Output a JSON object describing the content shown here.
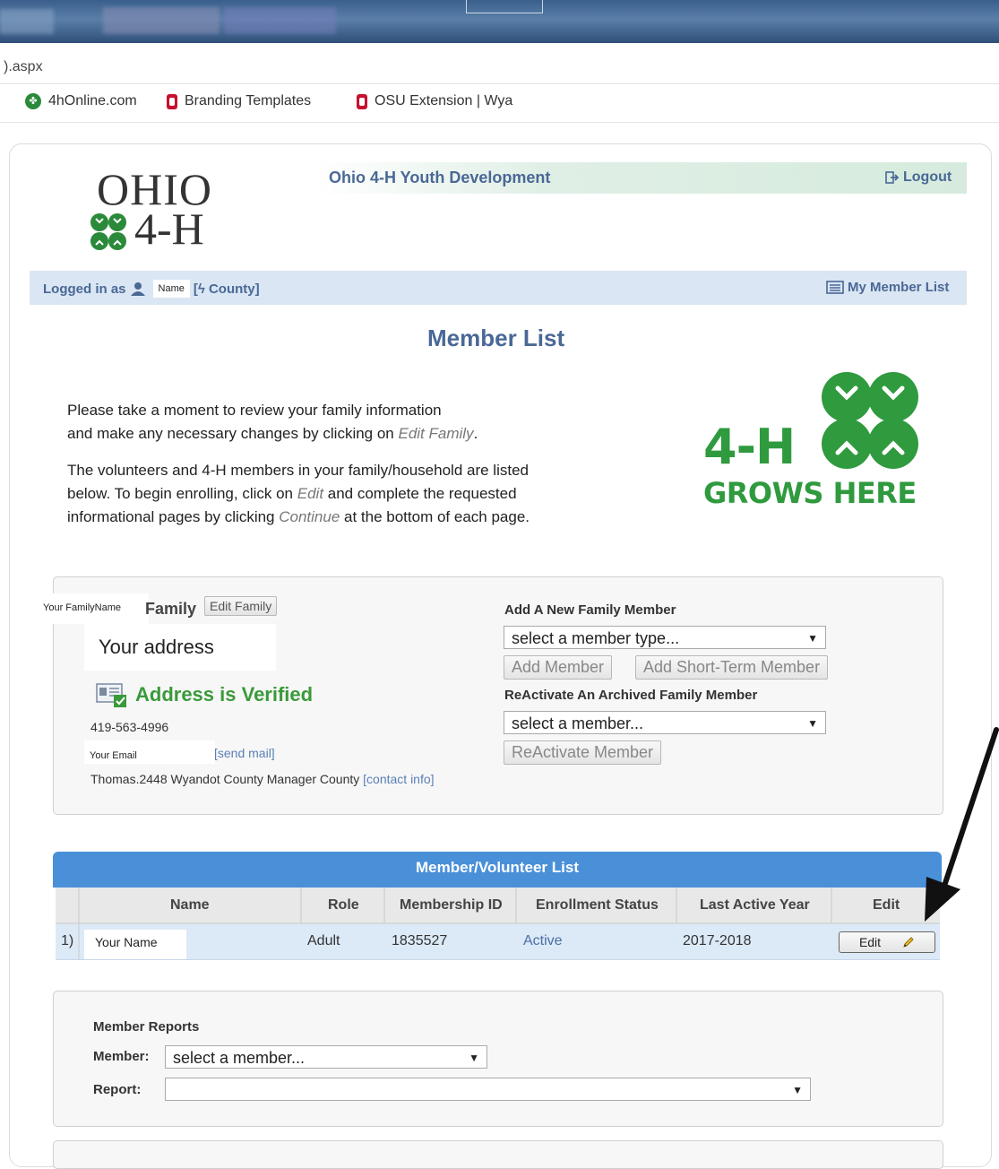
{
  "browser": {
    "url_fragment": ").aspx",
    "bookmarks": [
      {
        "label": "4hOnline.com",
        "icon": "clover-icon"
      },
      {
        "label": "Branding Templates",
        "icon": "osu-o-icon"
      },
      {
        "label": "OSU Extension | Wya",
        "icon": "osu-o-icon"
      }
    ]
  },
  "header": {
    "logo_line1": "OHIO",
    "logo_line2": "4-H",
    "site_title": "Ohio 4-H Youth Development",
    "logout": "Logout"
  },
  "login_bar": {
    "logged_in_as": "Logged in as",
    "name": "Name",
    "county": "[ϟ County]",
    "my_member_list": "My Member List"
  },
  "page": {
    "title": "Member List",
    "intro1_line1": "Please take a moment to review your family information",
    "intro1_line2_pre": "and make any necessary changes by clicking on ",
    "intro1_line2_em": "Edit Family",
    "intro1_line2_post": ".",
    "intro2_line1": "The volunteers and 4-H members in your family/household are listed",
    "intro2_line2_pre": "below. To begin enrolling, click on ",
    "intro2_line2_em": "Edit",
    "intro2_line2_post": " and complete the requested",
    "intro2_line3_pre": "informational pages by clicking ",
    "intro2_line3_em": "Continue",
    "intro2_line3_post": " at the bottom of each page.",
    "grows_line1": "4-H",
    "grows_line2": "GROWS HERE"
  },
  "family": {
    "family_name": "Your FamilyName",
    "family_label": "Family",
    "edit_family": "Edit Family",
    "address": "Your address",
    "verified": "Address is Verified",
    "phone": "419-563-4996",
    "email": "Your Email",
    "send_mail": "[send mail]",
    "manager": "Thomas.2448 Wyandot County Manager County ",
    "contact_info": "[contact info]",
    "add_heading": "Add A New Family Member",
    "member_type_select": "select a member type...",
    "add_member": "Add Member",
    "add_short_term": "Add Short-Term Member",
    "reactivate_heading": "ReActivate An Archived Family Member",
    "member_select": "select a member...",
    "reactivate_button": "ReActivate Member"
  },
  "member_table": {
    "title": "Member/Volunteer List",
    "columns": [
      "Name",
      "Role",
      "Membership ID",
      "Enrollment Status",
      "Last Active Year",
      "Edit"
    ],
    "rows": [
      {
        "index": "1)",
        "name": "Your Name",
        "role": "Adult",
        "membership_id": "1835527",
        "status": "Active",
        "last_active_year": "2017-2018",
        "edit": "Edit"
      }
    ]
  },
  "reports": {
    "heading": "Member Reports",
    "member_label": "Member:",
    "member_select": "select a member...",
    "report_label": "Report:",
    "report_select": ""
  },
  "colors": {
    "accent_blue": "#4a6896",
    "table_header": "#4a90d9",
    "verified_green": "#3a9a3a",
    "clover_green": "#2a8a3a",
    "osu_red": "#c8102e"
  }
}
